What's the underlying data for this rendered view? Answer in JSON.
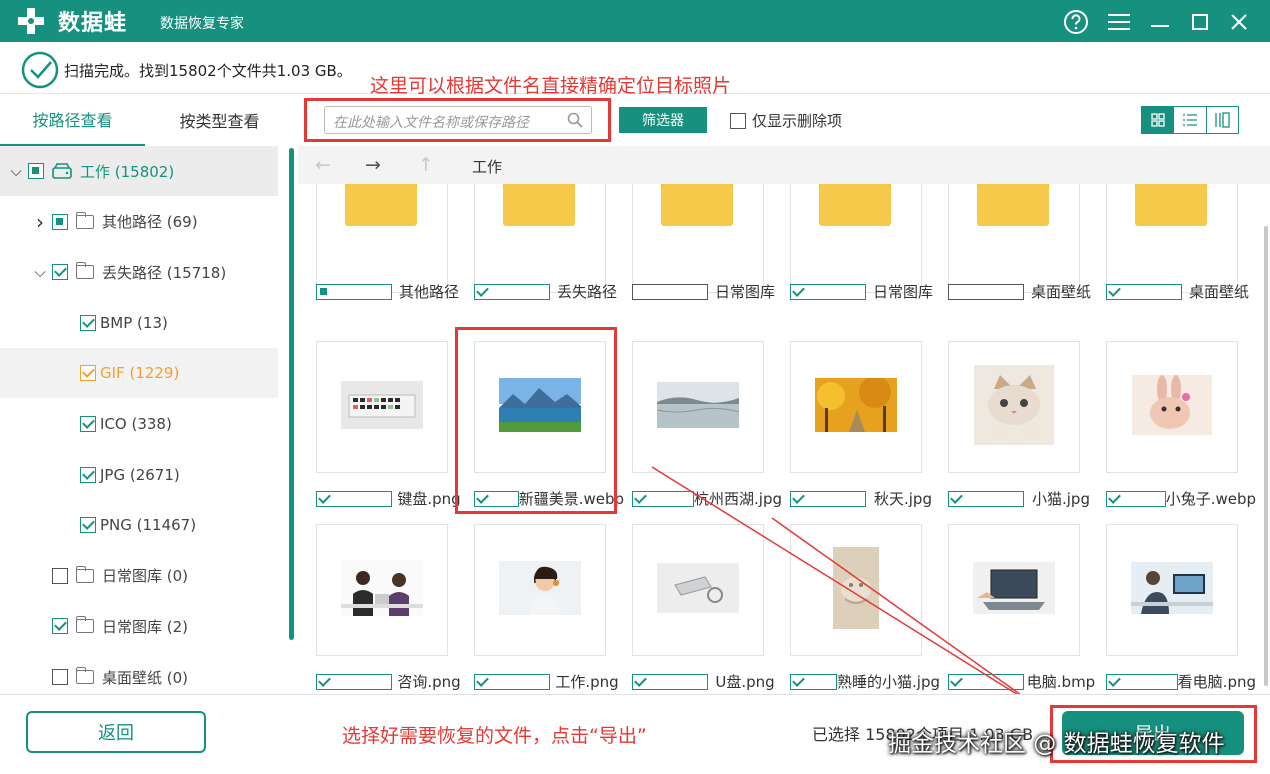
{
  "titlebar": {
    "logo_text": "数据蛙",
    "app_name": "数据恢复专家",
    "icons": [
      "help-icon",
      "menu-icon",
      "minimize-icon",
      "maximize-icon",
      "close-icon"
    ]
  },
  "status": {
    "text": "扫描完成。找到15802个文件共1.03 GB。"
  },
  "annotations": {
    "top": "这里可以根据文件名直接精确定位目标照片",
    "bottom": "选择好需要恢复的文件，点击“导出”"
  },
  "sidebar": {
    "tabs": [
      {
        "label": "按路径查看",
        "active": true
      },
      {
        "label": "按类型查看",
        "active": false
      }
    ],
    "tree": [
      {
        "label": "工作 (15802)",
        "state": "partial",
        "expand": "down",
        "icon": "drive-icon",
        "indent": 0
      },
      {
        "label": "其他路径 (69)",
        "state": "partial",
        "expand": "right",
        "icon": "folder-icon",
        "indent": 1
      },
      {
        "label": "丢失路径 (15718)",
        "state": "checked",
        "expand": "down",
        "icon": "folder-icon",
        "indent": 1
      },
      {
        "label": "BMP (13)",
        "state": "checked",
        "indent": 2
      },
      {
        "label": "GIF (1229)",
        "state": "checked",
        "indent": 2,
        "color": "orange"
      },
      {
        "label": "ICO (338)",
        "state": "checked",
        "indent": 2
      },
      {
        "label": "JPG (2671)",
        "state": "checked",
        "indent": 2
      },
      {
        "label": "PNG (11467)",
        "state": "checked",
        "indent": 2
      },
      {
        "label": "日常图库 (0)",
        "state": "unchecked",
        "icon": "folder-icon",
        "indent": 1
      },
      {
        "label": "日常图库 (2)",
        "state": "checked",
        "icon": "folder-icon",
        "indent": 1
      },
      {
        "label": "桌面壁纸 (0)",
        "state": "unchecked",
        "icon": "folder-icon",
        "indent": 1
      }
    ]
  },
  "toolbar": {
    "search_placeholder": "在此处输入文件名称或保存路径",
    "filter_label": "筛选器",
    "only_deleted_label": "仅显示删除项"
  },
  "nav": {
    "breadcrumb": "工作"
  },
  "files": [
    {
      "name": "其他路径",
      "type": "folder",
      "state": "partial"
    },
    {
      "name": "丢失路径",
      "type": "folder",
      "state": "checked"
    },
    {
      "name": "日常图库",
      "type": "folder",
      "state": "unchecked"
    },
    {
      "name": "日常图库",
      "type": "folder",
      "state": "checked"
    },
    {
      "name": "桌面壁纸",
      "type": "folder",
      "state": "unchecked"
    },
    {
      "name": "桌面壁纸",
      "type": "folder",
      "state": "checked"
    },
    {
      "name": "键盘.png",
      "type": "image",
      "thumb": "keyboard",
      "state": "checked"
    },
    {
      "name": "新疆美景.webp",
      "type": "image",
      "thumb": "lake-mountains",
      "state": "checked"
    },
    {
      "name": "杭州西湖.jpg",
      "type": "image",
      "thumb": "west-lake",
      "state": "checked"
    },
    {
      "name": "秋天.jpg",
      "type": "image",
      "thumb": "autumn",
      "state": "checked"
    },
    {
      "name": "小猫.jpg",
      "type": "image",
      "thumb": "kitten",
      "state": "checked"
    },
    {
      "name": "小兔子.webp",
      "type": "image",
      "thumb": "rabbit",
      "state": "checked"
    },
    {
      "name": "咨询.png",
      "type": "image",
      "thumb": "consult",
      "state": "checked"
    },
    {
      "name": "工作.png",
      "type": "image",
      "thumb": "headset",
      "state": "checked"
    },
    {
      "name": "U盘.png",
      "type": "image",
      "thumb": "usb",
      "state": "checked"
    },
    {
      "name": "熟睡的小猫.jpg",
      "type": "image",
      "thumb": "sleeping-cat",
      "state": "checked"
    },
    {
      "name": "电脑.bmp",
      "type": "image",
      "thumb": "laptop",
      "state": "checked"
    },
    {
      "name": "看电脑.png",
      "type": "image",
      "thumb": "laptop-user",
      "state": "checked"
    }
  ],
  "bottom": {
    "back_label": "返回",
    "selection_info": "已选择 15802个项目 1.03 GB",
    "export_label": "导出",
    "watermark": "掘金技术社区 @ 数据蛙恢复软件"
  },
  "colors": {
    "accent": "#17917f",
    "annotation": "#e53935",
    "folder": "#f7c342"
  }
}
